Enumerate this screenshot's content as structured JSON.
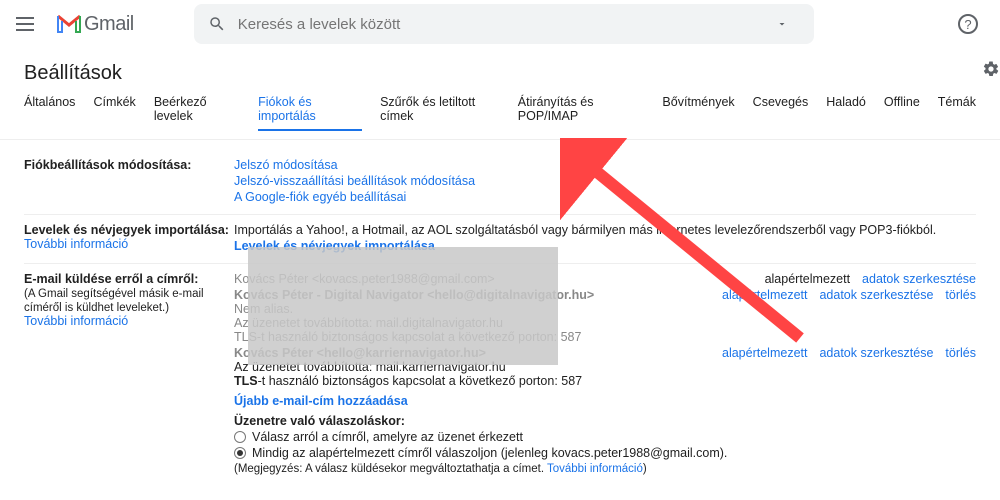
{
  "header": {
    "logo_text": "Gmail",
    "search_placeholder": "Keresés a levelek között"
  },
  "page_title": "Beállítások",
  "tabs": [
    "Általános",
    "Címkék",
    "Beérkező levelek",
    "Fiókok és importálás",
    "Szűrők és letiltott címek",
    "Átirányítás és POP/IMAP",
    "Bővítmények",
    "Csevegés",
    "Haladó",
    "Offline",
    "Témák"
  ],
  "active_tab": 3,
  "acct": {
    "title": "Fiókbeállítások módosítása:",
    "link1": "Jelszó módosítása",
    "link2": "Jelszó-visszaállítási beállítások módosítása",
    "link3": "A Google-fiók egyéb beállításai"
  },
  "import": {
    "title": "Levelek és névjegyek importálása:",
    "more": "További információ",
    "desc": "Importálás a Yahoo!, a Hotmail, az AOL szolgáltatásból vagy bármilyen más internetes levelezőrendszerből vagy POP3-fiókból.",
    "action": "Levelek és névjegyek importálása"
  },
  "sendas": {
    "title": "E-mail küldése erről a címről:",
    "sub": "(A Gmail segítségével másik e-mail címéről is küldhet leveleket.)",
    "more": "További információ",
    "rows": [
      {
        "name": "Kovács Péter <kovacs.peter1988@gmail.com>",
        "default_label": "alapértelmezett",
        "edit": "adatok szerkesztése",
        "del": ""
      },
      {
        "name": "Kovács Péter - Digital Navigator <hello@digitalnavigator.hu>",
        "sub1": "Nem alias.",
        "sub2": "Az üzenetet továbbította: mail.digitalnavigator.hu",
        "sub3": "TLS-t használó biztonságos kapcsolat a következő porton: 587",
        "default_label": "alapértelmezett",
        "edit": "adatok szerkesztése",
        "del": "törlés"
      },
      {
        "name": "Kovács Péter <hello@karriernavigator.hu>",
        "sub2": "Az üzenetet továbbította: mail.karriernavigator.hu",
        "sub3": "TLS-t használó biztonságos kapcsolat a következő porton: 587",
        "default_label": "alapértelmezett",
        "edit": "adatok szerkesztése",
        "del": "törlés"
      }
    ],
    "add": "Újabb e-mail-cím hozzáadása",
    "reply_title": "Üzenetre való válaszoláskor:",
    "reply_opt1": "Válasz arról a címről, amelyre az üzenet érkezett",
    "reply_opt2": "Mindig az alapértelmezett címről válaszoljon (jelenleg kovacs.peter1988@gmail.com).",
    "reply_note_pre": "(Megjegyzés: A válasz küldésekor megváltoztathatja a címet. ",
    "reply_note_link": "További információ",
    "reply_note_suf": ")"
  }
}
